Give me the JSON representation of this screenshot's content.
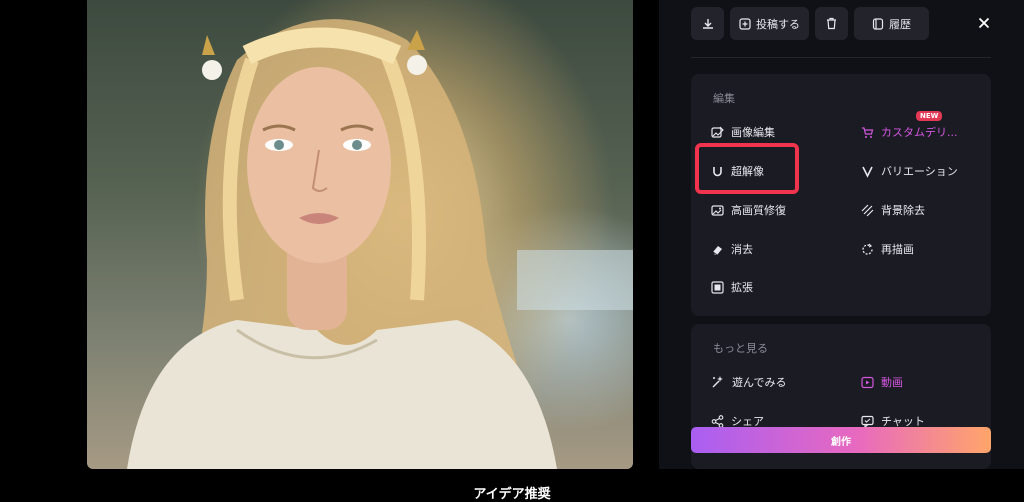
{
  "toolbar": {
    "download_icon": "download-icon",
    "post_label": "投稿する",
    "delete_icon": "trash-icon",
    "history_label": "履歴",
    "close_icon": "close-icon"
  },
  "edit": {
    "title": "編集",
    "items": [
      {
        "label": "画像編集",
        "icon": "image-edit-icon"
      },
      {
        "label": "カスタムデリ...",
        "icon": "cart-icon",
        "badge": "NEW"
      },
      {
        "label": "超解像",
        "icon": "upscale-icon"
      },
      {
        "label": "バリエーション",
        "icon": "variation-icon"
      },
      {
        "label": "高画質修復",
        "icon": "restore-icon"
      },
      {
        "label": "背景除去",
        "icon": "background-remove-icon"
      },
      {
        "label": "消去",
        "icon": "eraser-icon"
      },
      {
        "label": "再描画",
        "icon": "redraw-icon"
      },
      {
        "label": "拡張",
        "icon": "expand-icon"
      }
    ]
  },
  "more": {
    "title": "もっと見る",
    "items": [
      {
        "label": "遊んでみる",
        "icon": "play-magic-icon"
      },
      {
        "label": "動画",
        "icon": "video-icon"
      },
      {
        "label": "シェア",
        "icon": "share-icon"
      },
      {
        "label": "チャット",
        "icon": "chat-icon"
      }
    ]
  },
  "create_label": "創作",
  "bottom_title": "アイデア推奨",
  "colors": {
    "accent_pink": "#d457e0",
    "highlight": "#f0344e",
    "badge": "#e23a55",
    "panel_bg": "#101117",
    "card_bg": "#1a1b23"
  }
}
